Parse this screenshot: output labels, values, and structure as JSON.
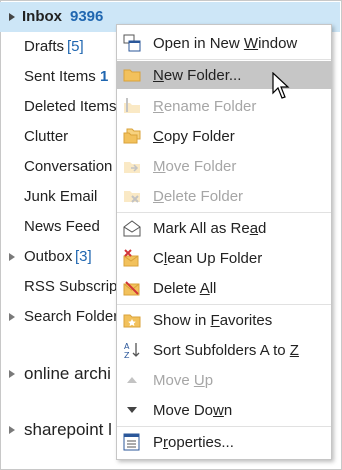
{
  "folders": [
    {
      "label": "Inbox",
      "count": "9396",
      "expandable": true,
      "selected": true
    },
    {
      "label": "Drafts",
      "count": "[5]"
    },
    {
      "label": "Sent Items",
      "count": "1"
    },
    {
      "label": "Deleted Items"
    },
    {
      "label": "Clutter"
    },
    {
      "label": "Conversation"
    },
    {
      "label": "Junk Email"
    },
    {
      "label": "News Feed"
    },
    {
      "label": "Outbox",
      "count": "[3]",
      "expandable": true
    },
    {
      "label": "RSS Subscript"
    },
    {
      "label": "Search Folder",
      "expandable": true
    },
    {
      "label": "online archi",
      "expandable": true
    },
    {
      "label": "sharepoint l",
      "expandable": true
    }
  ],
  "menu": {
    "items": [
      {
        "pre": "Open in New ",
        "ul": "W",
        "post": "indow",
        "icon": "open-new-window-icon",
        "disabled": false
      },
      {
        "pre": "",
        "ul": "N",
        "post": "ew Folder...",
        "icon": "new-folder-icon",
        "disabled": false,
        "hover": true
      },
      {
        "pre": "",
        "ul": "R",
        "post": "ename Folder",
        "icon": "rename-folder-icon",
        "disabled": true
      },
      {
        "pre": "",
        "ul": "C",
        "post": "opy Folder",
        "icon": "copy-folder-icon",
        "disabled": false
      },
      {
        "pre": "",
        "ul": "M",
        "post": "ove Folder",
        "icon": "move-folder-icon",
        "disabled": true
      },
      {
        "pre": "",
        "ul": "D",
        "post": "elete Folder",
        "icon": "delete-folder-icon",
        "disabled": true
      },
      {
        "pre": "Mark All as Re",
        "ul": "a",
        "post": "d",
        "icon": "mark-read-icon",
        "disabled": false
      },
      {
        "pre": "C",
        "ul": "l",
        "post": "ean Up Folder",
        "icon": "clean-up-icon",
        "disabled": false
      },
      {
        "pre": "Delete ",
        "ul": "A",
        "post": "ll",
        "icon": "delete-all-icon",
        "disabled": false
      },
      {
        "pre": "Show in ",
        "ul": "F",
        "post": "avorites",
        "icon": "favorites-icon",
        "disabled": false
      },
      {
        "pre": "Sort Subfolders A to ",
        "ul": "Z",
        "post": "",
        "icon": "sort-az-icon",
        "disabled": false
      },
      {
        "pre": "Move ",
        "ul": "U",
        "post": "p",
        "icon": "move-up-icon",
        "disabled": true
      },
      {
        "pre": "Move Do",
        "ul": "w",
        "post": "n",
        "icon": "move-down-icon",
        "disabled": false
      },
      {
        "pre": "P",
        "ul": "r",
        "post": "operties...",
        "icon": "properties-icon",
        "disabled": false
      }
    ]
  },
  "colors": {
    "selection": "#cde6f7",
    "count": "#1f66b0",
    "hover": "#c6c6c6",
    "folder": "#f2c15c"
  }
}
